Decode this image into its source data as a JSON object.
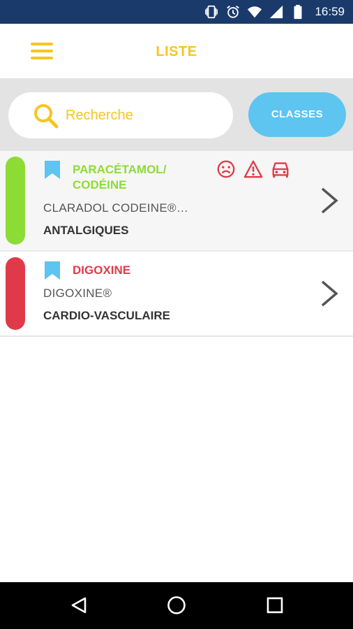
{
  "status_bar": {
    "time": "16:59",
    "icons": [
      "vibrate-icon",
      "alarm-icon",
      "wifi-icon",
      "signal-icon",
      "battery-icon"
    ]
  },
  "app_bar": {
    "title": "LISTE",
    "menu_icon": "hamburger-menu-icon"
  },
  "search": {
    "placeholder": "Recherche",
    "icon": "search-icon"
  },
  "classes_button": {
    "label": "CLASSES"
  },
  "list": {
    "items": [
      {
        "name": "PARACÉTAMOL/ CODÉINE",
        "name_line1": "PARACÉTAMOL/",
        "name_line2": "CODÉINE",
        "brand": "CLARADOL CODEINE®…",
        "category": "ANTALGIQUES",
        "status_color": "#8ddc35",
        "name_color": "#8ddc35",
        "warning_icons": [
          "sad-face-icon",
          "warning-triangle-icon",
          "car-icon"
        ]
      },
      {
        "name": "DIGOXINE",
        "brand": "DIGOXINE®",
        "category": "CARDIO-VASCULAIRE",
        "status_color": "#e03a4a",
        "name_color": "#e03a4a",
        "warning_icons": []
      }
    ]
  },
  "nav_bar": {
    "icons": [
      "back-icon",
      "home-icon",
      "recents-icon"
    ]
  },
  "colors": {
    "accent_yellow": "#f7c51e",
    "accent_blue": "#5ec4f0",
    "status_bar": "#1a3a6b",
    "warning_red": "#e03a4a",
    "ok_green": "#8ddc35"
  }
}
